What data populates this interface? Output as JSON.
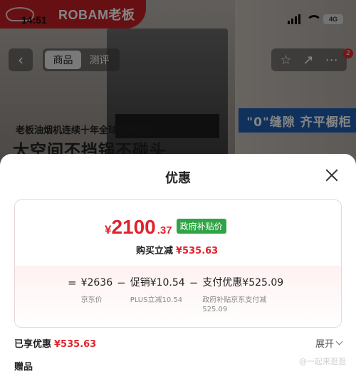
{
  "status_bar": {
    "time": "14:51",
    "battery": "4G"
  },
  "brand": {
    "logo_text": "ROBAM老板"
  },
  "nav": {
    "tabs": [
      {
        "label": "商品",
        "active": true
      },
      {
        "label": "测评",
        "active": false
      }
    ],
    "cart_badge": "2"
  },
  "banner": {
    "promo_line_prefix": "老板油烟机连续十年",
    "promo_line_bold": "全球销量领先",
    "headline": "大空间不挡锅不碰头",
    "sign": "\"0\"缝隙 齐平橱柜"
  },
  "sheet": {
    "title": "优惠",
    "price": {
      "currency": "¥",
      "integer": "2100",
      "decimal": ".37",
      "badge": "政府补贴价"
    },
    "instant_discount": {
      "label": "购买立减",
      "value": "¥535.63"
    },
    "breakdown": {
      "eq": "=",
      "minus": "−",
      "terms": [
        {
          "main": "¥2636",
          "sub": "京东价"
        },
        {
          "main": "促销¥10.54",
          "sub": "PLUS立减10.54"
        },
        {
          "main": "支付优惠¥525.09",
          "sub": "政府补贴京东支付减525.09"
        }
      ]
    },
    "enjoyed": {
      "label": "已享优惠",
      "value": "¥535.63"
    },
    "expand_label": "展开",
    "gift_label": "赠品",
    "watermark": "@一起来逛逛"
  },
  "colors": {
    "brand_red": "#c62025",
    "price_red": "#e0232e",
    "gov_green": "#2fa447"
  }
}
